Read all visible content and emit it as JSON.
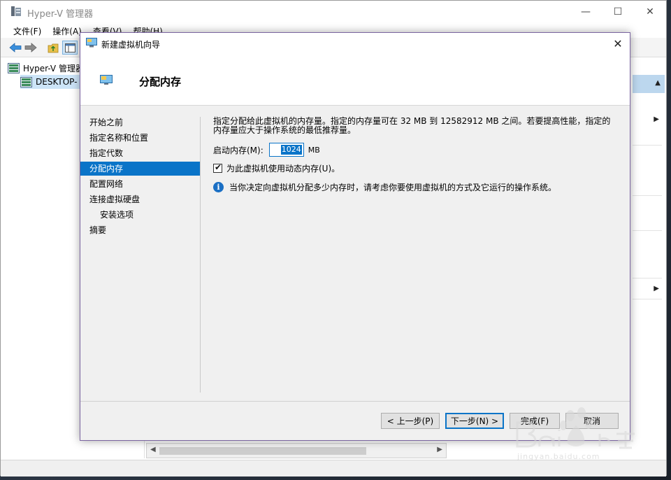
{
  "app": {
    "title": "Hyper-V 管理器"
  },
  "window_controls": {
    "minimize": "—",
    "maximize": "☐",
    "close": "✕"
  },
  "menu": [
    {
      "label": "文件(F)"
    },
    {
      "label": "操作(A)"
    },
    {
      "label": "查看(V)"
    },
    {
      "label": "帮助(H)"
    }
  ],
  "tree": {
    "root": "Hyper-V 管理器",
    "child": "DESKTOP-"
  },
  "wizard": {
    "title": "新建虚拟机向导",
    "close": "✕",
    "page_title": "分配内存",
    "steps": [
      {
        "label": "开始之前"
      },
      {
        "label": "指定名称和位置"
      },
      {
        "label": "指定代数"
      },
      {
        "label": "分配内存"
      },
      {
        "label": "配置网络"
      },
      {
        "label": "连接虚拟硬盘"
      },
      {
        "label": "安装选项"
      },
      {
        "label": "摘要"
      }
    ],
    "description": "指定分配给此虚拟机的内存量。指定的内存量可在 32 MB 到 12582912 MB 之间。若要提高性能，指定的内存量应大于操作系统的最低推荐量。",
    "startup_memory_label": "启动内存(M):",
    "startup_memory_value": "1024",
    "startup_memory_unit": "MB",
    "dynamic_memory_label": "为此虚拟机使用动态内存(U)。",
    "dynamic_memory_checked": true,
    "info_text": "当你决定向虚拟机分配多少内存时，请考虑你要使用虚拟机的方式及它运行的操作系统。",
    "buttons": {
      "back": "< 上一步(P)",
      "next": "下一步(N) >",
      "finish": "完成(F)",
      "cancel": "取消"
    }
  },
  "watermark": {
    "url": "jingyan.baidu.com"
  },
  "colors": {
    "selection": "#0a74c8",
    "accent_border": "#7a64a0"
  }
}
